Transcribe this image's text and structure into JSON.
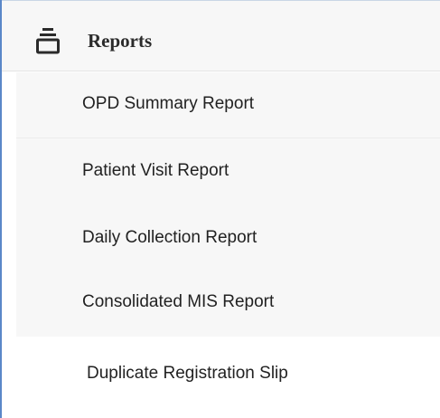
{
  "menu": {
    "section_title": "Reports",
    "section_icon": "report-stack-icon",
    "items": [
      {
        "label": "OPD Summary Report"
      },
      {
        "label": "Patient Visit Report"
      },
      {
        "label": "Daily Collection Report"
      },
      {
        "label": "Consolidated MIS Report"
      }
    ],
    "next_item": {
      "label": "Duplicate Registration Slip"
    }
  },
  "colors": {
    "accent_border": "#5a87c8",
    "panel_bg": "#f7f7f7",
    "text": "#222222"
  }
}
